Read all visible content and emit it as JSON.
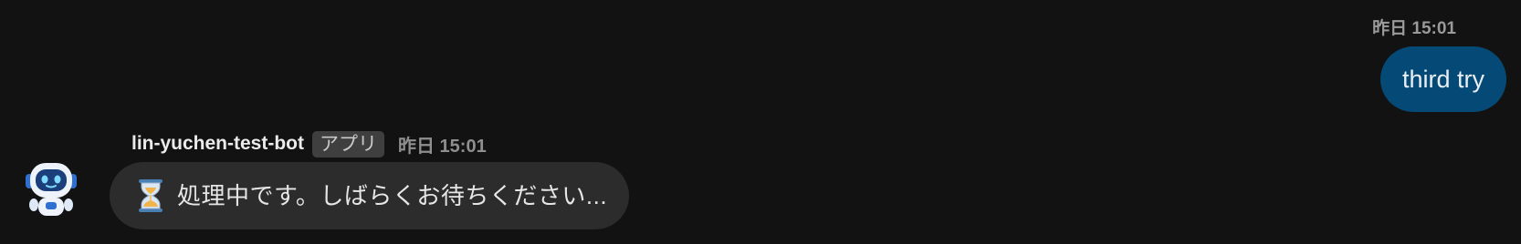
{
  "outgoing": {
    "timestamp": "昨日 15:01",
    "text": "third try",
    "bubble_color": "#054a77"
  },
  "incoming": {
    "sender": "lin-yuchen-test-bot",
    "badge": "アプリ",
    "timestamp": "昨日 15:01",
    "text": "処理中です。しばらくお待ちください...",
    "icon": "hourglass-icon",
    "avatar": "robot-avatar",
    "bubble_color": "#2c2c2c"
  },
  "theme": {
    "background": "#121212"
  }
}
